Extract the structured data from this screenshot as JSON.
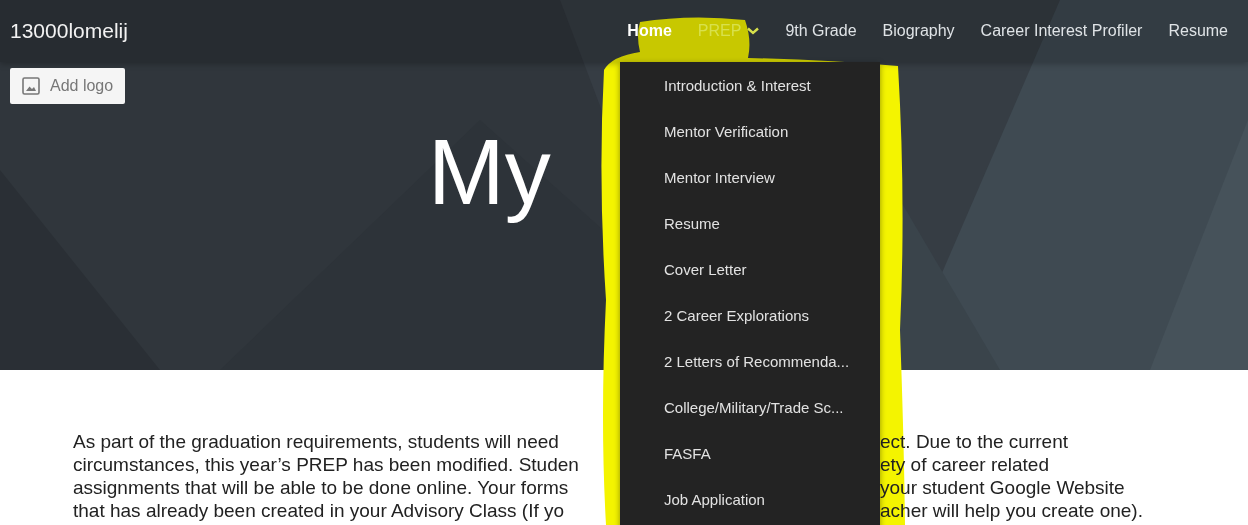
{
  "site_title": "13000lomelij",
  "nav": [
    {
      "label": "Home",
      "selected": true,
      "expanded": false
    },
    {
      "label": "PREP",
      "selected": false,
      "expanded": true
    },
    {
      "label": "9th Grade",
      "selected": false,
      "expanded": false
    },
    {
      "label": "Biography",
      "selected": false,
      "expanded": false
    },
    {
      "label": "Career Interest Profiler",
      "selected": false,
      "expanded": false
    },
    {
      "label": "Resume",
      "selected": false,
      "expanded": false
    }
  ],
  "add_logo": "Add logo",
  "hero_title": "My",
  "dropdown": [
    "Introduction & Interest",
    "Mentor Verification",
    "Mentor Interview",
    "Resume",
    "Cover Letter",
    "2 Career Explorations",
    "2 Letters of Recommenda...",
    "College/Military/Trade Sc...",
    "FASFA",
    "Job Application"
  ],
  "paragraph_lines": [
    {
      "left": "As part of the graduation requirements, students will need",
      "right": "ect. Due to the current"
    },
    {
      "left": "circumstances, this year’s PREP has been modified. Studen",
      "right": "ety of career related"
    },
    {
      "left": "assignments that will be able to be done online. Your forms",
      "right": "your student Google Website"
    },
    {
      "left": "that has already been created in your Advisory Class (If yo",
      "right": "acher will help you create one)."
    }
  ]
}
